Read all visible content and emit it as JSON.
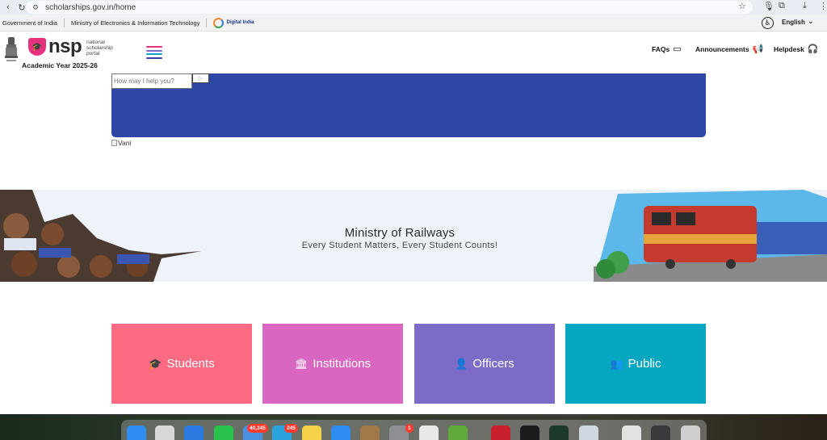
{
  "browser": {
    "url": "scholarships.gov.in/home"
  },
  "govbar": {
    "items": [
      "Government of India",
      "Ministry of Electronics & Information Technology"
    ],
    "digital_india": "Digital India",
    "language": "English"
  },
  "header": {
    "logo_text": "nsp",
    "logo_sub": "national scholarship portal",
    "academic_year": "Academic Year 2025-26",
    "nav": {
      "faqs": "FAQs",
      "announcements": "Announcements",
      "helpdesk": "Helpdesk"
    }
  },
  "chat": {
    "placeholder": "How may I help you?",
    "image_alt": "Vani"
  },
  "banner": {
    "title": "Ministry of Railways",
    "subtitle": "Every Student Matters, Every Student Counts!"
  },
  "cards": [
    {
      "label": "Students",
      "color": "#fc6b82",
      "icon": "graduation-cap-icon"
    },
    {
      "label": "Institutions",
      "color": "#d966c0",
      "icon": "institution-icon"
    },
    {
      "label": "Officers",
      "color": "#7c6cc8",
      "icon": "user-icon"
    },
    {
      "label": "Public",
      "color": "#07a7c2",
      "icon": "users-icon"
    }
  ],
  "dock": {
    "mail_badge": "40,345",
    "telegram_badge": "245",
    "settings_badge": "1"
  },
  "colors": {
    "chat_banner": "#2e47a5",
    "nsp_pink": "#e6317f"
  }
}
